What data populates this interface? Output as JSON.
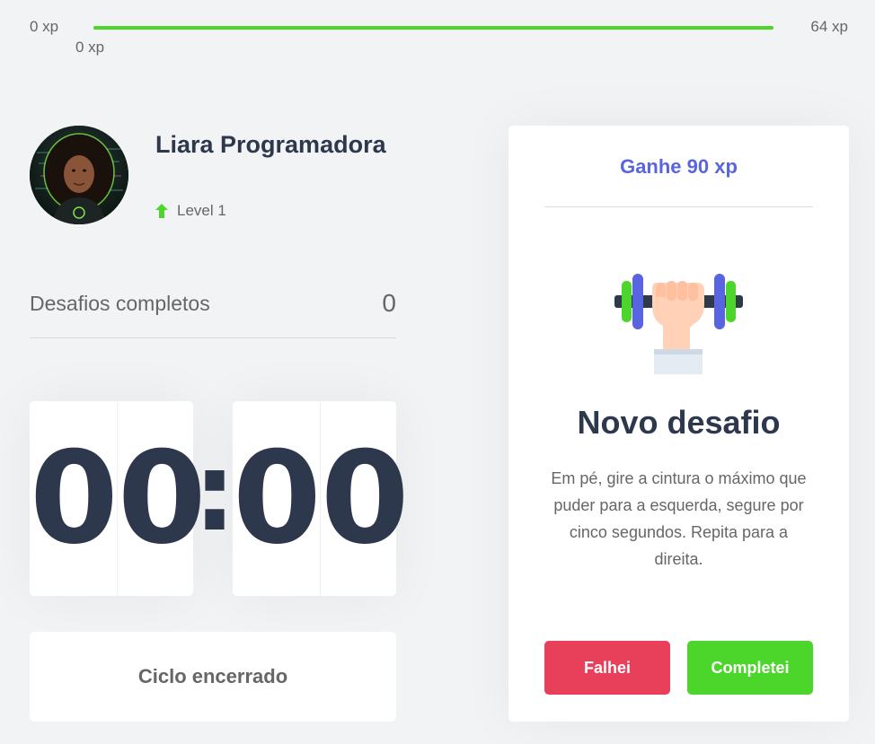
{
  "xp": {
    "min_label": "0 xp",
    "max_label": "64 xp",
    "current_label": "0 xp",
    "progress": 1.0,
    "bar_color": "#4cd62b"
  },
  "profile": {
    "name": "Liara Programadora",
    "level_label": "Level 1",
    "level_icon": "level-up-arrow-icon"
  },
  "completed": {
    "label": "Desafios completos",
    "value": "0"
  },
  "countdown": {
    "minute_left": "0",
    "minute_right": "0",
    "separator": ":",
    "second_left": "0",
    "second_right": "0"
  },
  "cycle_button": {
    "label": "Ciclo encerrado"
  },
  "challenge": {
    "reward_label": "Ganhe 90 xp",
    "icon": "dumbbell-icon",
    "title": "Novo desafio",
    "description": "Em pé, gire a cintura o máximo que puder para a esquerda, segure por cinco segundos. Repita para a direita.",
    "fail_label": "Falhei",
    "success_label": "Completei"
  },
  "colors": {
    "accent_blue": "#5965e0",
    "fail_red": "#e83f5b",
    "success_green": "#4cd62b",
    "text_dark": "#2e384d"
  }
}
